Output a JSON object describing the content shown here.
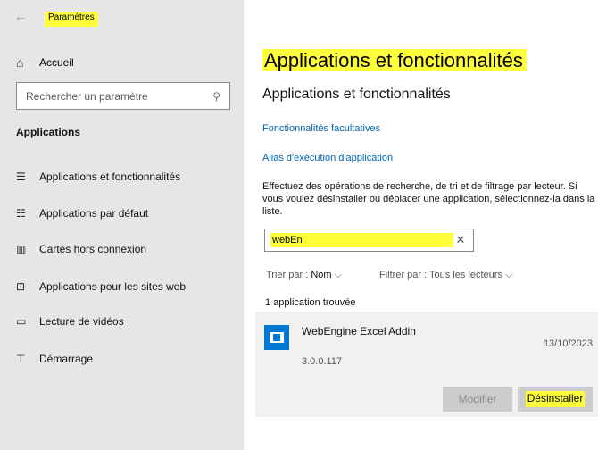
{
  "window": {
    "title": "Paramètres",
    "back_icon": "arrow-left-icon"
  },
  "sidebar": {
    "home_label": "Accueil",
    "search_placeholder": "Rechercher un paramètre",
    "section_title": "Applications",
    "items": [
      {
        "label": "Applications et fonctionnalités",
        "icon": "apps-features-icon"
      },
      {
        "label": "Applications par défaut",
        "icon": "default-apps-icon"
      },
      {
        "label": "Cartes hors connexion",
        "icon": "offline-maps-icon"
      },
      {
        "label": "Applications pour les sites web",
        "icon": "apps-websites-icon"
      },
      {
        "label": "Lecture de vidéos",
        "icon": "video-playback-icon"
      },
      {
        "label": "Démarrage",
        "icon": "startup-icon"
      }
    ]
  },
  "main": {
    "page_title": "Applications et fonctionnalités",
    "section_title": "Applications et fonctionnalités",
    "links": [
      "Fonctionnalités facultatives",
      "Alias d'exécution d'application"
    ],
    "description": "Effectuez des opérations de recherche, de tri et de filtrage par lecteur. Si vous voulez désinstaller ou déplacer une application, sélectionnez-la dans la liste.",
    "filter_value": "webEn",
    "sort_label": "Trier par :",
    "sort_value": "Nom",
    "filter_label": "Filtrer par :",
    "filter_drive": "Tous les lecteurs",
    "result_count": "1 application trouvée",
    "app": {
      "name": "WebEngine Excel Addin",
      "date": "13/10/2023",
      "version": "3.0.0.117",
      "modify_label": "Modifier",
      "uninstall_label": "Désinstaller"
    }
  },
  "colors": {
    "highlight": "#ffff3a",
    "link": "#0063b1",
    "accent": "#0078d4",
    "sidebar_bg": "#e6e6e6"
  }
}
